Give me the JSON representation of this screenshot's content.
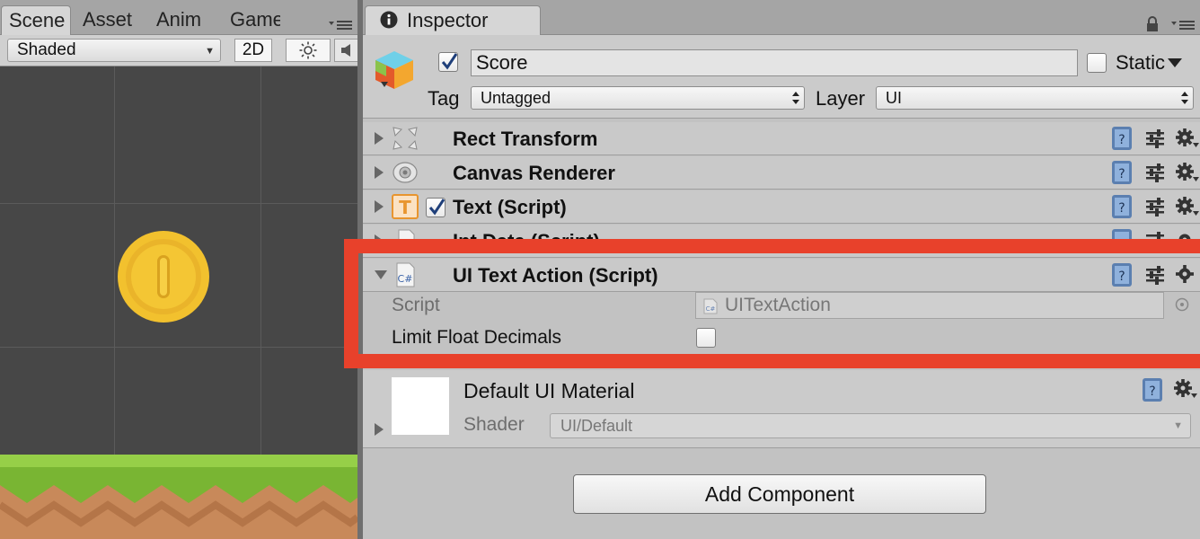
{
  "scene_panel": {
    "tabs": [
      {
        "label": "Scene",
        "active": true
      },
      {
        "label": "Asset",
        "active": false
      },
      {
        "label": "Anim",
        "active": false
      },
      {
        "label": "Game",
        "active": false
      }
    ],
    "toolbar": {
      "shading_mode": "Shaded",
      "mode_2d_label": "2D",
      "lighting_icon": "sun-icon",
      "audio_icon": "speaker-icon"
    },
    "view": {
      "background_color": "#474747",
      "objects": [
        "coin-sprite",
        "ground-tiles"
      ]
    }
  },
  "inspector": {
    "tab_label": "Inspector",
    "game_object": {
      "active": true,
      "name": "Score",
      "static_label": "Static",
      "static_checked": false,
      "tag_label": "Tag",
      "tag_value": "Untagged",
      "layer_label": "Layer",
      "layer_value": "UI"
    },
    "components": [
      {
        "title": "Rect Transform",
        "icon": "rect-transform-icon",
        "expanded": false
      },
      {
        "title": "Canvas Renderer",
        "icon": "canvas-renderer-icon",
        "expanded": false
      },
      {
        "title": "Text (Script)",
        "icon": "text-t-icon",
        "expanded": false,
        "enabled": true
      },
      {
        "title": "Int Data (Script)",
        "icon": "script-file-icon",
        "expanded": false
      },
      {
        "title": "UI Text Action (Script)",
        "icon": "csharp-script-icon",
        "expanded": true
      }
    ],
    "ui_text_action": {
      "script_label": "Script",
      "script_value": "UITextAction",
      "limit_float_label": "Limit Float Decimals",
      "limit_float_checked": false
    },
    "material": {
      "name": "Default UI Material",
      "shader_label": "Shader",
      "shader_value": "UI/Default"
    },
    "add_component_label": "Add Component"
  },
  "colors": {
    "highlight_border": "#e8412b",
    "panel_bg": "#c2c2c2",
    "scene_bg": "#474747",
    "coin": "#f2c12e",
    "grass": "#8cc63f",
    "dirt": "#c8895a"
  }
}
